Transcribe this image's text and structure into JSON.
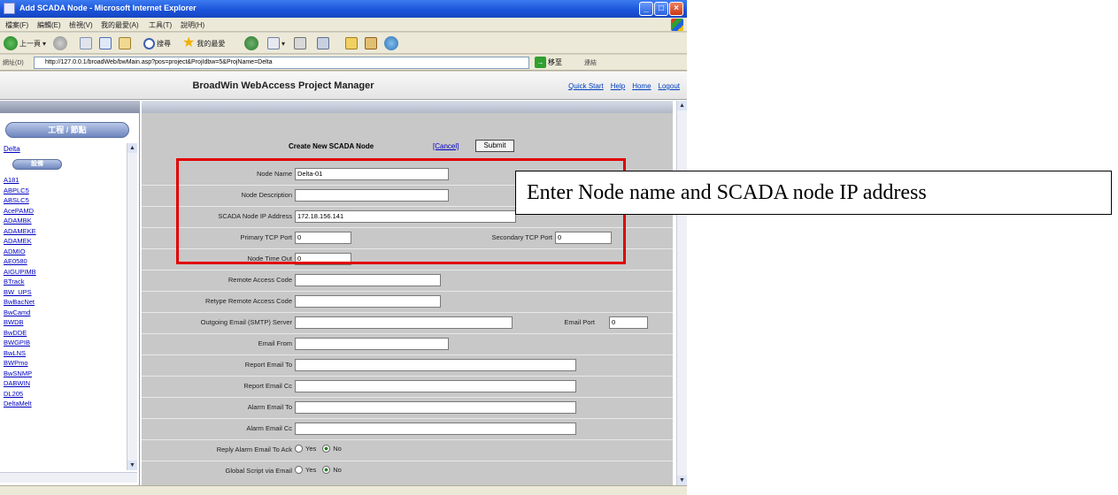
{
  "window": {
    "title": "Add SCADA Node - Microsoft Internet Explorer"
  },
  "menubar": {
    "items": [
      "檔案(F)",
      "編輯(E)",
      "檢視(V)",
      "我的最愛(A)",
      "工具(T)",
      "說明(H)"
    ]
  },
  "toolbar": {
    "back_label": "上一頁",
    "search_label": "搜尋",
    "favorites_label": "我的最愛"
  },
  "addressbar": {
    "label": "網址(D)",
    "url": "http://127.0.0.1/broadWeb/bwMain.asp?pos=project&ProjIdbw=5&ProjName=Delta",
    "go_label": "移至",
    "links_label": "連結"
  },
  "app": {
    "title": "BroadWin WebAccess Project Manager",
    "links": [
      "Quick Start",
      "Help",
      "Home",
      "Logout"
    ]
  },
  "sidebar": {
    "section_pill": "工程 / 節點",
    "project": "Delta",
    "sub_pill": "設備",
    "items": [
      "A181",
      "ABPLC5",
      "ABSLC5",
      "AcePAMD",
      "ADAMBK",
      "ADAMEKE",
      "ADAMEK",
      "ADMIO",
      "AE0580",
      "AIGUPIMB",
      "BTrack",
      "BW_UPS",
      "BwBacNet",
      "BwCamd",
      "BWDB",
      "BwDDE",
      "BWGPIB",
      "BwLNS",
      "BWPmo",
      "BwSNMP",
      "DABWIN",
      "DL205",
      "DeltaMelt"
    ]
  },
  "form": {
    "header_title": "Create New SCADA Node",
    "cancel_label": "[Cancel]",
    "submit_label": "Submit",
    "fields": {
      "node_name": {
        "label": "Node Name",
        "value": "Delta-01"
      },
      "node_description": {
        "label": "Node Description",
        "value": ""
      },
      "scada_ip": {
        "label": "SCADA Node IP Address",
        "value": "172.18.156.141"
      },
      "primary_tcp_port": {
        "label": "Primary TCP Port",
        "value": "0"
      },
      "secondary_tcp_port": {
        "label": "Secondary TCP Port",
        "value": "0"
      },
      "node_timeout": {
        "label": "Node Time Out",
        "value": "0"
      },
      "remote_access_code": {
        "label": "Remote Access Code",
        "value": ""
      },
      "retype_remote_access_code": {
        "label": "Retype Remote Access Code",
        "value": ""
      },
      "smtp_server": {
        "label": "Outgoing Email (SMTP) Server",
        "value": ""
      },
      "email_port": {
        "label": "Email Port",
        "value": "0"
      },
      "email_from": {
        "label": "Email From",
        "value": ""
      },
      "report_email_to": {
        "label": "Report Email To",
        "value": ""
      },
      "report_email_cc": {
        "label": "Report Email Cc",
        "value": ""
      },
      "alarm_email_to": {
        "label": "Alarm Email To",
        "value": ""
      },
      "alarm_email_cc": {
        "label": "Alarm Email Cc",
        "value": ""
      },
      "reply_alarm_email": {
        "label": "Reply Alarm Email To Ack",
        "yes": "Yes",
        "no": "No",
        "selected": "No"
      },
      "global_script_email": {
        "label": "Global Script via Email",
        "yes": "Yes",
        "no": "No",
        "selected": "No"
      }
    }
  },
  "annotation": {
    "callout_text": "Enter Node name and SCADA node IP address",
    "highlight_color": "#e00000"
  }
}
